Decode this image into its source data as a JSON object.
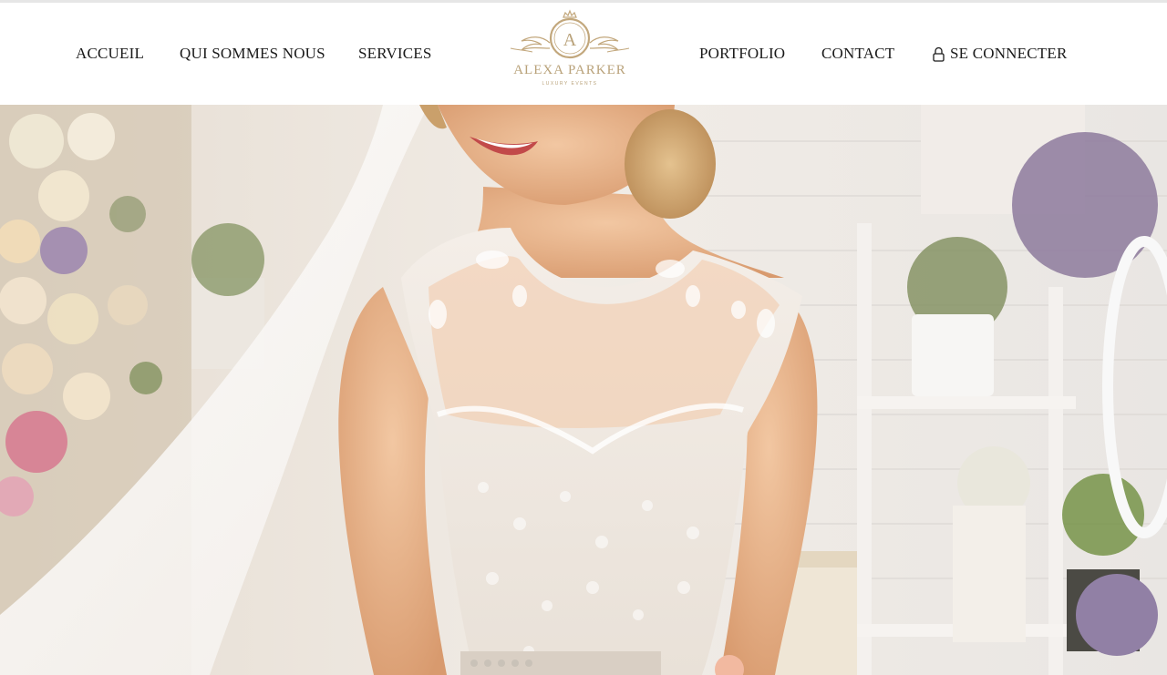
{
  "nav": {
    "left": [
      {
        "label": "ACCUEIL"
      },
      {
        "label": "QUI SOMMES NOUS"
      },
      {
        "label": "SERVICES"
      }
    ],
    "right": [
      {
        "label": "PORTFOLIO"
      },
      {
        "label": "CONTACT"
      }
    ],
    "login": {
      "label": "SE CONNECTER",
      "icon": "lock-icon"
    }
  },
  "logo": {
    "monogram": "A",
    "brand": "ALEXA PARKER",
    "tagline": "LUXURY EVENTS",
    "color": "#b9a27a"
  },
  "hero": {
    "image": "bride-in-lace-wedding-dress-photo"
  }
}
